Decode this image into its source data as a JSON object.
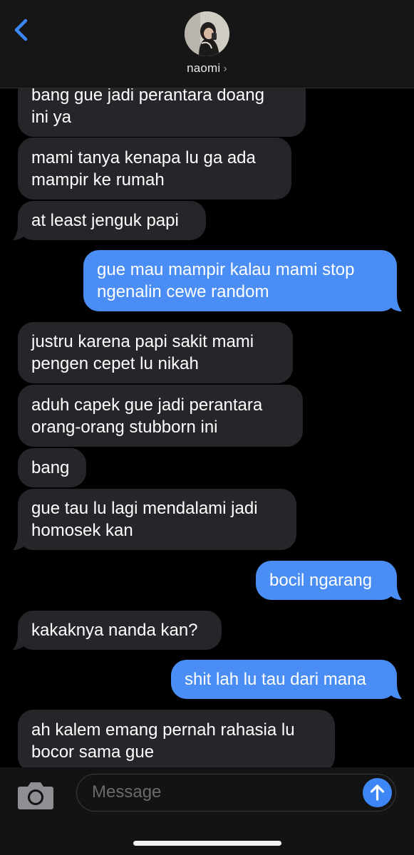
{
  "header": {
    "contact_name": "naomi",
    "chevron": "›",
    "back_icon": "chevron-left-icon"
  },
  "messages": [
    {
      "direction": "received",
      "lines": [
        "bang gue jadi perantara doang",
        "ini ya"
      ]
    },
    {
      "direction": "received",
      "lines": [
        "mami tanya kenapa lu ga ada",
        "mampir ke rumah"
      ]
    },
    {
      "direction": "received",
      "lines": [
        "at least jenguk papi"
      ]
    },
    {
      "direction": "sent",
      "lines": [
        "gue mau mampir kalau mami stop",
        "ngenalin cewe random"
      ]
    },
    {
      "direction": "received",
      "lines": [
        "justru karena papi sakit mami",
        "pengen cepet lu nikah"
      ]
    },
    {
      "direction": "received",
      "lines": [
        "aduh capek gue jadi perantara",
        "orang-orang stubborn ini"
      ]
    },
    {
      "direction": "received",
      "lines": [
        "bang"
      ]
    },
    {
      "direction": "received",
      "lines": [
        "gue tau lu lagi mendalami jadi",
        "homosek kan"
      ]
    },
    {
      "direction": "sent",
      "lines": [
        "bocil ngarang"
      ]
    },
    {
      "direction": "received",
      "lines": [
        "kakaknya nanda kan?"
      ]
    },
    {
      "direction": "sent",
      "lines": [
        "shit lah lu tau dari mana"
      ]
    },
    {
      "direction": "received",
      "lines": [
        "ah kalem emang pernah rahasia lu",
        "bocor sama gue"
      ]
    }
  ],
  "composer": {
    "placeholder": "Message",
    "camera_icon": "camera-icon",
    "send_icon": "arrow-up-icon"
  },
  "colors": {
    "received_bubble": "#26252a",
    "sent_bubble": "#4a8ef5",
    "accent": "#3d86f6",
    "background": "#000000"
  }
}
